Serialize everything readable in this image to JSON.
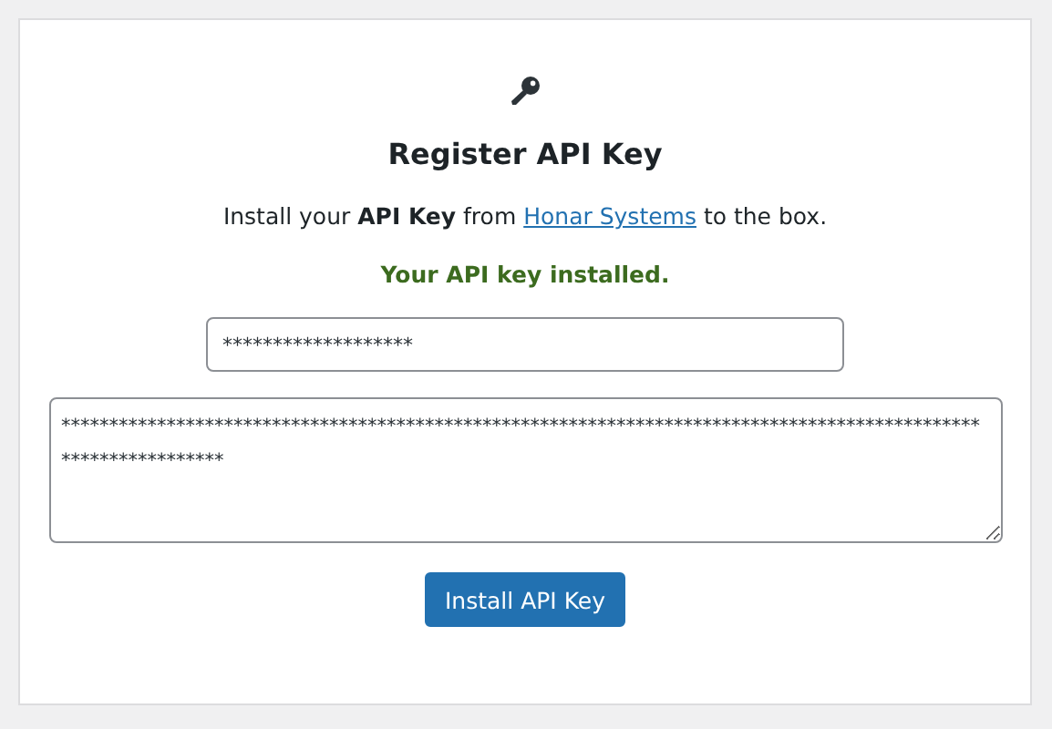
{
  "title": "Register API Key",
  "description": {
    "before": "Install your **API Key** from ",
    "link": "Honar Systems",
    "after": " to the box."
  },
  "status": {
    "text": "Your API key installed.",
    "kind": "success"
  },
  "key_field": {
    "value": "*******************"
  },
  "key_area": {
    "value": "*****************************************************************************************************************"
  },
  "button": "Install API Key"
}
